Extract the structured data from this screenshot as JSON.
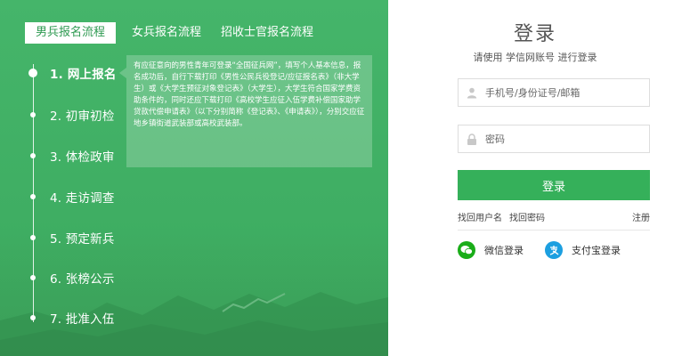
{
  "tabs": [
    "男兵报名流程",
    "女兵报名流程",
    "招收士官报名流程"
  ],
  "steps": [
    "1. 网上报名",
    "2. 初审初检",
    "3. 体检政审",
    "4. 走访调查",
    "5. 预定新兵",
    "6. 张榜公示",
    "7. 批准入伍"
  ],
  "step_description": "有应征意向的男性青年可登录“全国征兵网”，填写个人基本信息，报名成功后，自行下载打印《男性公民兵役登记/应征报名表》（非大学生）或《大学生预征对象登记表》（大学生），大学生符合国家学费资助条件的，同时还应下载打印《高校学生应征入伍学费补偿国家助学贷款代偿申请表》（以下分别简称《登记表》、《申请表》），分别交应征 地乡镇街道武装部或高校武装部。",
  "login": {
    "title": "登录",
    "subtitle": "请使用  学信网账号  进行登录",
    "username_placeholder": "手机号/身份证号/邮箱",
    "password_placeholder": "密码",
    "submit_label": "登录",
    "find_username": "找回用户名",
    "find_password": "找回密码",
    "register": "注册",
    "wechat_login": "微信登录",
    "alipay_login": "支付宝登录"
  },
  "colors": {
    "brand_green": "#35b05a",
    "left_panel_green": "#45b56a",
    "wechat": "#1aad19",
    "alipay": "#1c9fe0"
  },
  "icons": {
    "username": "user-icon",
    "password": "lock-icon",
    "wechat": "wechat-icon",
    "alipay": "alipay-icon"
  }
}
